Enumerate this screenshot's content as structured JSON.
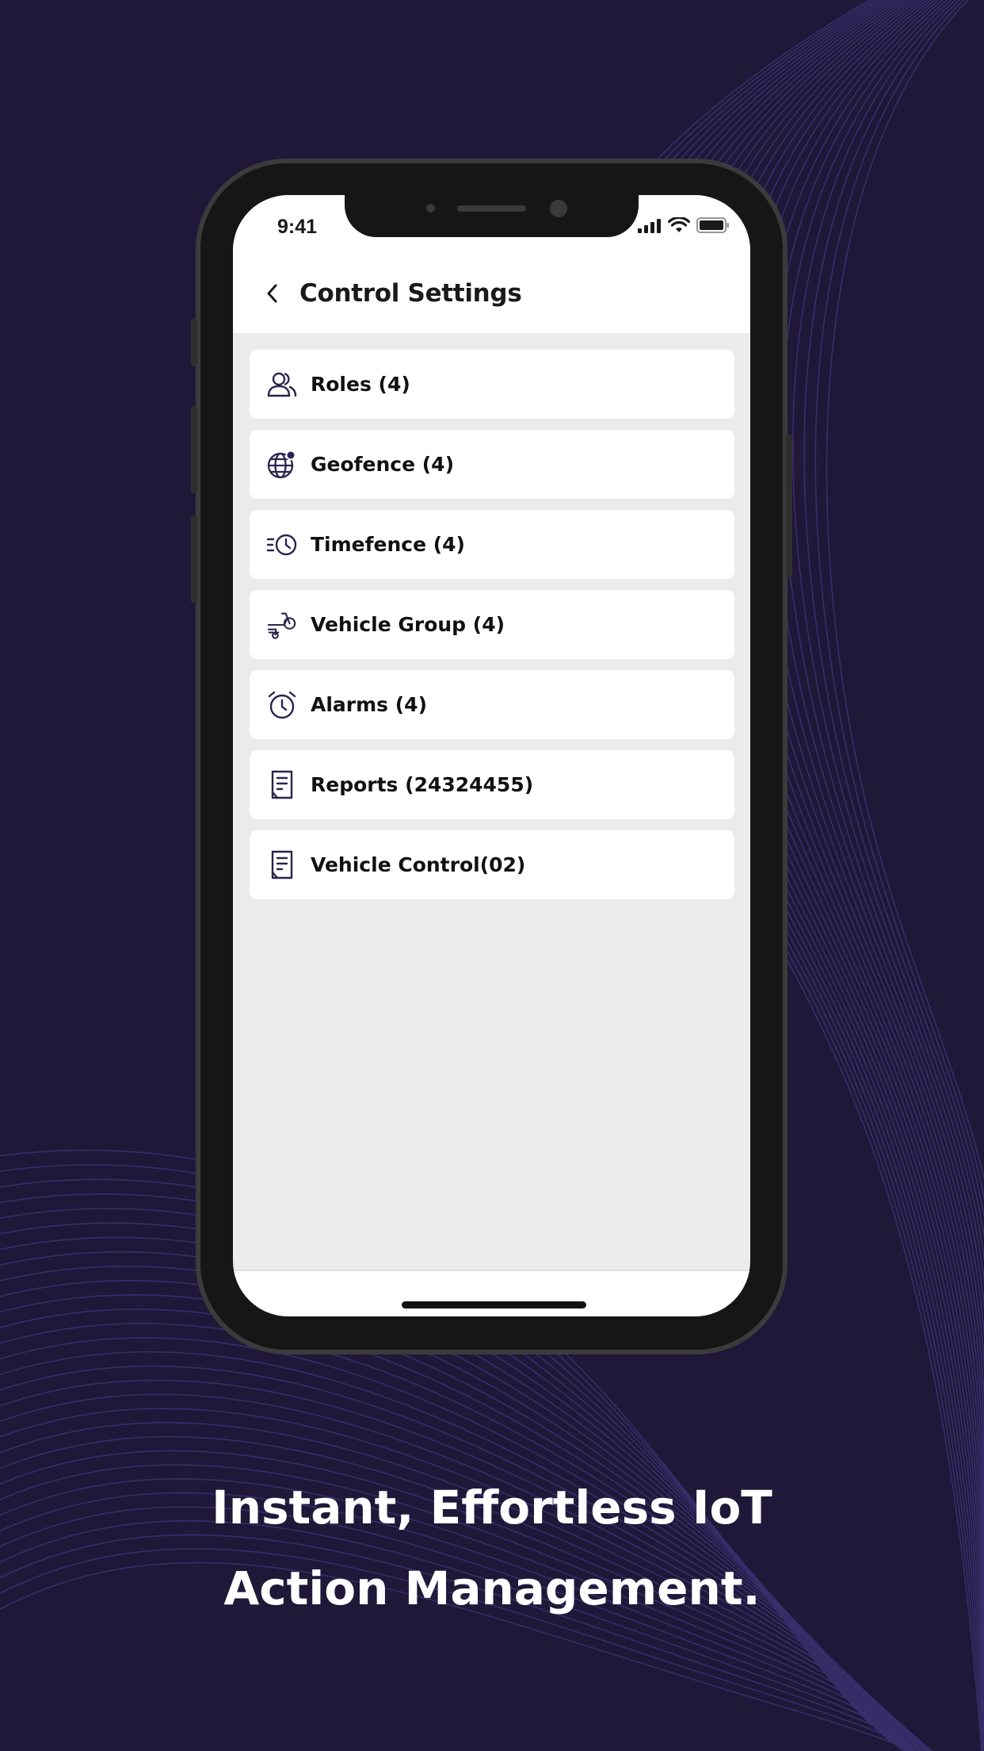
{
  "status_bar": {
    "time": "9:41",
    "icons": [
      "cellular-signal-icon",
      "wifi-icon",
      "battery-icon"
    ]
  },
  "header": {
    "back_icon": "chevron-left-icon",
    "title": "Control Settings"
  },
  "list": [
    {
      "icon": "users-icon",
      "label": "Roles (4)"
    },
    {
      "icon": "globe-pin-icon",
      "label": "Geofence (4)"
    },
    {
      "icon": "clock-speed-icon",
      "label": "Timefence (4)"
    },
    {
      "icon": "scooter-icon",
      "label": "Vehicle Group (4)"
    },
    {
      "icon": "alarm-clock-icon",
      "label": "Alarms (4)"
    },
    {
      "icon": "report-document-icon",
      "label": "Reports (24324455)"
    },
    {
      "icon": "report-document-icon",
      "label": "Vehicle Control(02)"
    }
  ],
  "tagline": {
    "line1": "Instant, Effortless IoT",
    "line2": "Action Management."
  },
  "colors": {
    "background": "#1f1838",
    "line_accent": "#3d3275",
    "icon": "#2a2450",
    "screen_bg": "#ebebeb"
  }
}
